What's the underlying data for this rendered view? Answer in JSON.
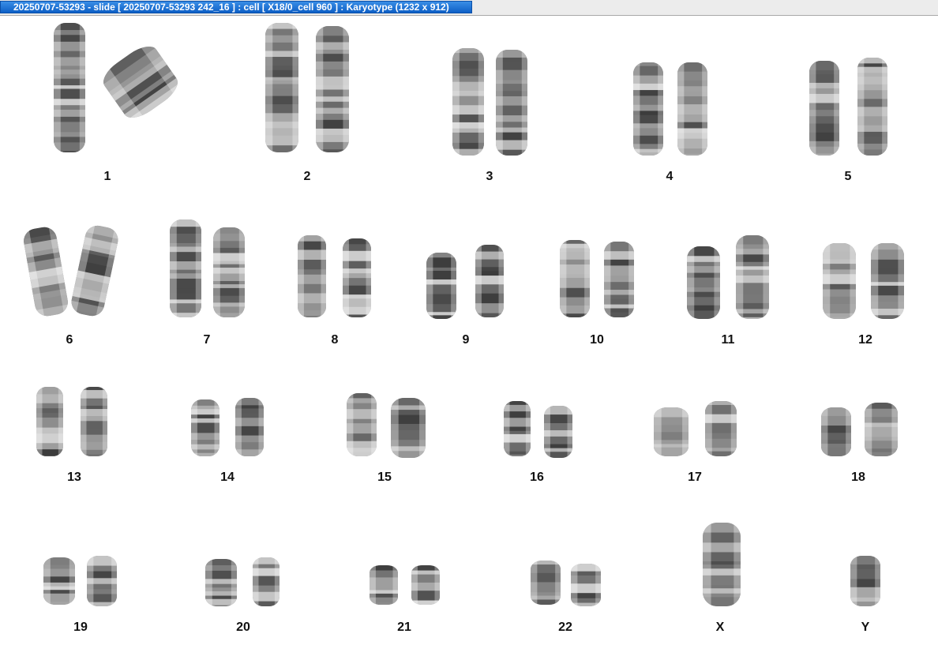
{
  "window": {
    "title": "20250707-53293 - slide [ 20250707-53293 242_16 ] : cell [ X18/0_cell 960 ] : Karyotype  (1232 x 912)"
  },
  "karyotype": {
    "chromosomes": [
      {
        "label": "1"
      },
      {
        "label": "2"
      },
      {
        "label": "3"
      },
      {
        "label": "4"
      },
      {
        "label": "5"
      },
      {
        "label": "6"
      },
      {
        "label": "7"
      },
      {
        "label": "8"
      },
      {
        "label": "9"
      },
      {
        "label": "10"
      },
      {
        "label": "11"
      },
      {
        "label": "12"
      },
      {
        "label": "13"
      },
      {
        "label": "14"
      },
      {
        "label": "15"
      },
      {
        "label": "16"
      },
      {
        "label": "17"
      },
      {
        "label": "18"
      },
      {
        "label": "19"
      },
      {
        "label": "20"
      },
      {
        "label": "21"
      },
      {
        "label": "22"
      },
      {
        "label": "X"
      },
      {
        "label": "Y"
      }
    ]
  }
}
